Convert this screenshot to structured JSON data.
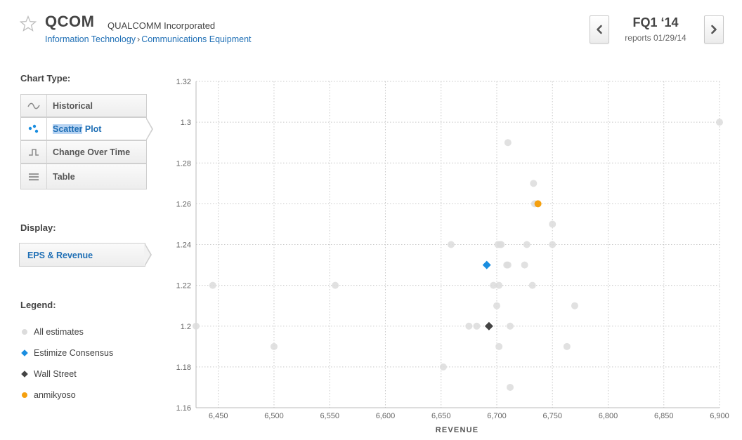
{
  "header": {
    "ticker": "QCOM",
    "company": "QUALCOMM Incorporated",
    "breadcrumb": [
      "Information Technology",
      "Communications Equipment"
    ],
    "breadcrumb_separator": "›",
    "quarter": "FQ1 ‘14",
    "reports": "reports 01/29/14",
    "prev_icon": "chevron-left-icon",
    "next_icon": "chevron-right-icon",
    "favorite_icon": "star-icon"
  },
  "sidebar": {
    "chart_type_title": "Chart Type:",
    "chart_types": [
      {
        "label": "Historical",
        "icon": "wave-icon",
        "selected": false
      },
      {
        "label": "Scatter Plot",
        "icon": "scatter-icon",
        "selected": true
      },
      {
        "label": "Change Over Time",
        "icon": "step-icon",
        "selected": false
      },
      {
        "label": "Table",
        "icon": "table-icon",
        "selected": false
      }
    ],
    "display_title": "Display:",
    "display_value": "EPS & Revenue",
    "legend_title": "Legend:",
    "legend": [
      {
        "label": "All estimates",
        "symbol": "circle",
        "color": "#dcdcdc"
      },
      {
        "label": "Estimize Consensus",
        "symbol": "diamond",
        "color": "#1a8ee0"
      },
      {
        "label": "Wall Street",
        "symbol": "diamond",
        "color": "#444444"
      },
      {
        "label": "anmikyoso",
        "symbol": "circle",
        "color": "#f5a00f"
      }
    ]
  },
  "chart_data": {
    "type": "scatter",
    "xlabel": "REVENUE",
    "ylabel": "",
    "xlim": [
      6430,
      6900
    ],
    "ylim": [
      1.16,
      1.32
    ],
    "x_ticks": [
      6450,
      6500,
      6550,
      6600,
      6650,
      6700,
      6750,
      6800,
      6850,
      6900
    ],
    "x_tick_labels": [
      "6,450",
      "6,500",
      "6,550",
      "6,600",
      "6,650",
      "6,700",
      "6,750",
      "6,800",
      "6,850",
      "6,900"
    ],
    "y_ticks": [
      1.16,
      1.18,
      1.2,
      1.22,
      1.24,
      1.26,
      1.28,
      1.3,
      1.32
    ],
    "y_tick_labels": [
      "1.16",
      "1.18",
      "1.2",
      "1.22",
      "1.24",
      "1.26",
      "1.28",
      "1.3",
      "1.32"
    ],
    "grid": true,
    "series": [
      {
        "name": "All estimates",
        "color": "#dcdcdc",
        "symbol": "circle",
        "points": [
          [
            6430,
            1.2
          ],
          [
            6445,
            1.22
          ],
          [
            6500,
            1.19
          ],
          [
            6555,
            1.22
          ],
          [
            6652,
            1.18
          ],
          [
            6659,
            1.24
          ],
          [
            6675,
            1.2
          ],
          [
            6682,
            1.2
          ],
          [
            6697,
            1.22
          ],
          [
            6700,
            1.21
          ],
          [
            6701,
            1.24
          ],
          [
            6702,
            1.22
          ],
          [
            6702,
            1.19
          ],
          [
            6703,
            1.24
          ],
          [
            6704,
            1.24
          ],
          [
            6709,
            1.23
          ],
          [
            6710,
            1.23
          ],
          [
            6710,
            1.29
          ],
          [
            6712,
            1.2
          ],
          [
            6712,
            1.17
          ],
          [
            6725,
            1.23
          ],
          [
            6727,
            1.24
          ],
          [
            6732,
            1.22
          ],
          [
            6733,
            1.27
          ],
          [
            6734,
            1.26
          ],
          [
            6750,
            1.25
          ],
          [
            6750,
            1.24
          ],
          [
            6763,
            1.19
          ],
          [
            6770,
            1.21
          ],
          [
            6900,
            1.3
          ]
        ]
      },
      {
        "name": "Estimize Consensus",
        "color": "#1a8ee0",
        "symbol": "diamond",
        "points": [
          [
            6691,
            1.23
          ]
        ]
      },
      {
        "name": "Wall Street",
        "color": "#444444",
        "symbol": "diamond",
        "points": [
          [
            6693,
            1.2
          ]
        ]
      },
      {
        "name": "anmikyoso",
        "color": "#f5a00f",
        "symbol": "circle",
        "points": [
          [
            6737,
            1.26
          ]
        ]
      }
    ]
  }
}
